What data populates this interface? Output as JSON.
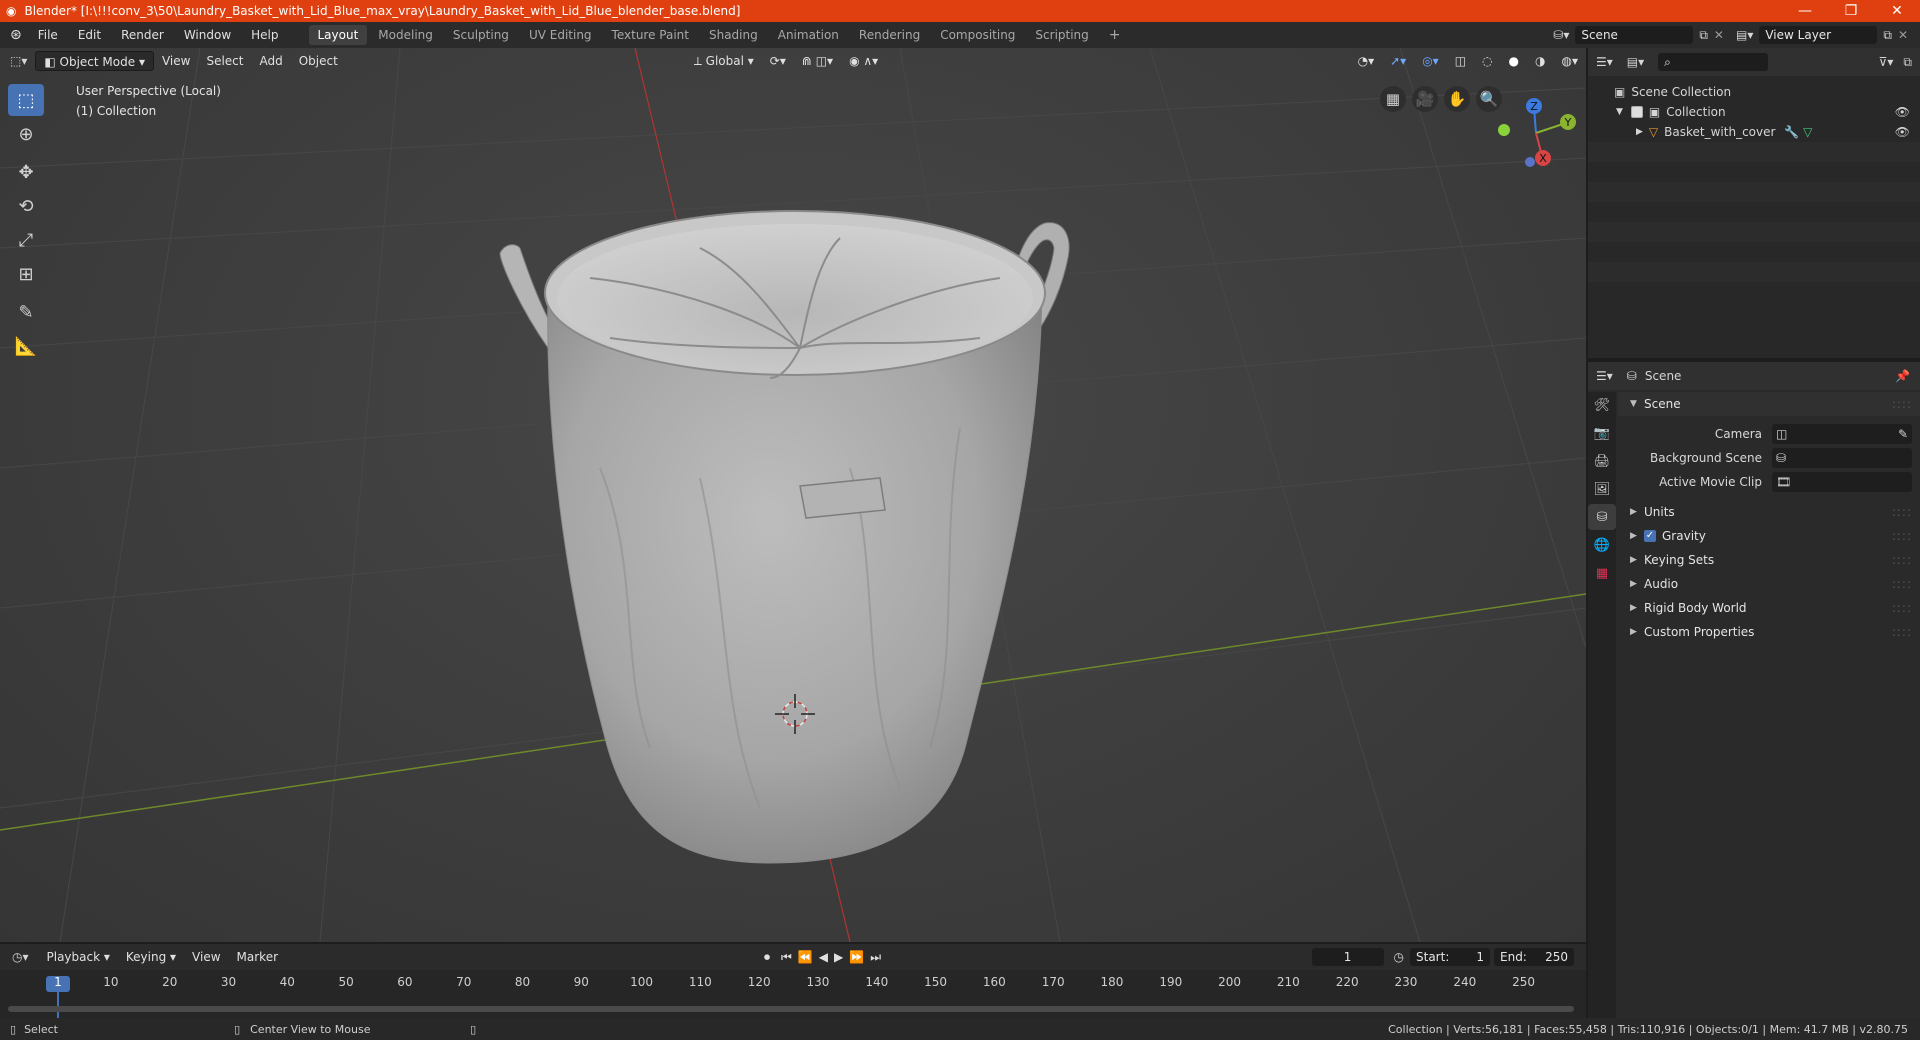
{
  "window": {
    "title": "Blender* [I:\\!!!conv_3\\50\\Laundry_Basket_with_Lid_Blue_max_vray\\Laundry_Basket_with_Lid_Blue_blender_base.blend]",
    "minimize": "—",
    "restore": "❐",
    "close": "✕"
  },
  "menu": {
    "items": [
      "File",
      "Edit",
      "Render",
      "Window",
      "Help"
    ]
  },
  "workspaces": [
    "Layout",
    "Modeling",
    "Sculpting",
    "UV Editing",
    "Texture Paint",
    "Shading",
    "Animation",
    "Rendering",
    "Compositing",
    "Scripting"
  ],
  "workspace_add": "+",
  "scene_selector": {
    "value": "Scene"
  },
  "viewlayer_selector": {
    "value": "View Layer"
  },
  "viewport_header": {
    "mode": "Object Mode",
    "menus": [
      "View",
      "Select",
      "Add",
      "Object"
    ],
    "orientation": "Global"
  },
  "viewport_overlay": {
    "perspective": "User Perspective (Local)",
    "collection": "(1) Collection"
  },
  "gizmo": {
    "z": "Z",
    "y": "Y",
    "x": "X"
  },
  "outliner": {
    "search_placeholder": "",
    "scene_collection": "Scene Collection",
    "collection": "Collection",
    "object": "Basket_with_cover"
  },
  "properties": {
    "header": "Scene",
    "section": "Scene",
    "camera_label": "Camera",
    "background_scene_label": "Background Scene",
    "active_movie_clip_label": "Active Movie Clip",
    "subsections": [
      "Units",
      "Gravity",
      "Keying Sets",
      "Audio",
      "Rigid Body World",
      "Custom Properties"
    ]
  },
  "timeline": {
    "menus": [
      "Playback",
      "Keying",
      "View",
      "Marker"
    ],
    "current_frame": "1",
    "start_label": "Start:",
    "start_value": "1",
    "end_label": "End:",
    "end_value": "250",
    "ruler": [
      "1",
      "10",
      "20",
      "30",
      "40",
      "50",
      "60",
      "70",
      "80",
      "90",
      "100",
      "110",
      "120",
      "130",
      "140",
      "150",
      "160",
      "170",
      "180",
      "190",
      "200",
      "210",
      "220",
      "230",
      "240",
      "250"
    ]
  },
  "statusbar": {
    "select": "Select",
    "center_view": "Center View to Mouse",
    "stats": "Collection | Verts:56,181 | Faces:55,458 | Tris:110,916 | Objects:0/1 | Mem: 41.7 MB | v2.80.75"
  },
  "colors": {
    "titlebar": "#e0400f",
    "accent": "#4772b3",
    "x_axis": "#c63b3b",
    "y_axis": "#7a9a2e"
  }
}
